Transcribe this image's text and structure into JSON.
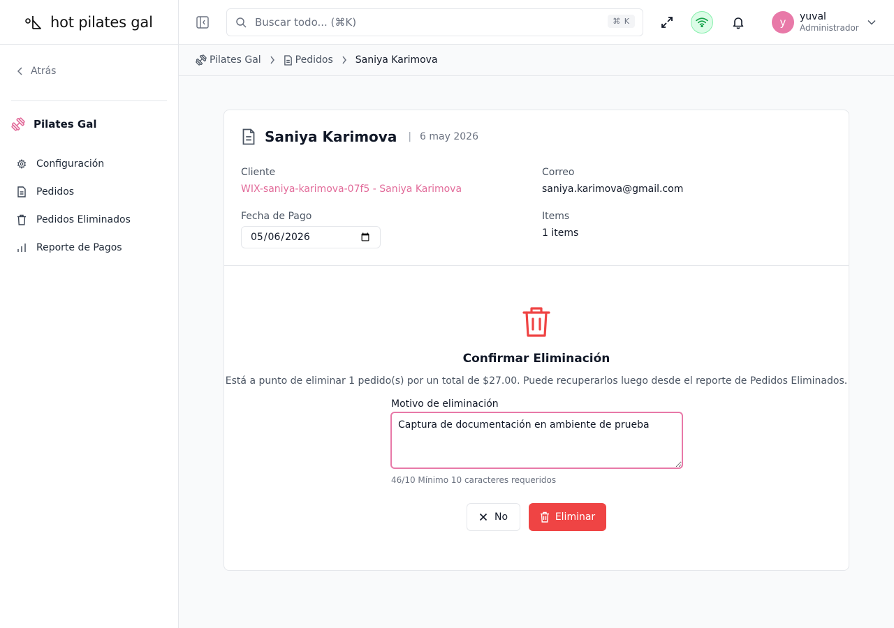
{
  "brand": {
    "logo_text": "hot pilates gal"
  },
  "sidebar": {
    "back_label": "Atrás",
    "org_name": "Pilates Gal",
    "items": [
      {
        "label": "Configuración",
        "icon": "gear-icon"
      },
      {
        "label": "Pedidos",
        "icon": "document-icon"
      },
      {
        "label": "Pedidos Eliminados",
        "icon": "trash-icon"
      },
      {
        "label": "Reporte de Pagos",
        "icon": "bar-chart-icon"
      }
    ]
  },
  "header": {
    "search_placeholder": "Buscar todo... (⌘K)",
    "search_shortcut": "⌘ K",
    "user_name": "yuval",
    "user_role": "Administrador",
    "avatar_initial": "y",
    "connection_status_color": "#22c55e"
  },
  "breadcrumb": {
    "items": [
      "Pilates Gal",
      "Pedidos"
    ],
    "current": "Saniya Karimova"
  },
  "order": {
    "title": "Saniya Karimova",
    "date": "6 may 2026",
    "client_label": "Cliente",
    "client_value": "WIX-saniya-karimova-07f5 - Saniya Karimova",
    "email_label": "Correo",
    "email_value": "saniya.karimova@gmail.com",
    "payment_date_label": "Fecha de Pago",
    "payment_date_value": "2026-05-06",
    "items_label": "Items",
    "items_value": "1 items"
  },
  "confirm": {
    "title": "Confirmar Eliminación",
    "description": "Está a punto de eliminar 1 pedido(s) por un total de $27.00. Puede recuperarlos luego desde el reporte de Pedidos Eliminados.",
    "reason_label": "Motivo de eliminación",
    "reason_value": "Captura de documentación en ambiente de prueba",
    "hint": "46/10 Mínimo 10 caracteres requeridos",
    "no_label": "No",
    "delete_label": "Eliminar"
  },
  "colors": {
    "accent": "#e879a8",
    "danger": "#ef4444"
  }
}
